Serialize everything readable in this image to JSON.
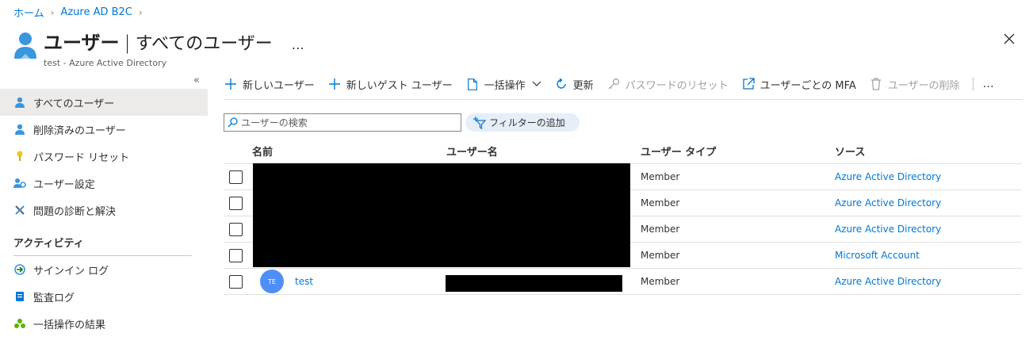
{
  "breadcrumb": [
    {
      "label": "ホーム"
    },
    {
      "label": "Azure AD B2C"
    }
  ],
  "header": {
    "title": "ユーザー",
    "separator": "|",
    "subtitle_view": "すべてのユーザー",
    "more": "…",
    "subtitle": "test - Azure Active Directory"
  },
  "sidebar": {
    "collapse": "«",
    "items": [
      {
        "label": "すべてのユーザー",
        "icon": "user-icon",
        "active": true
      },
      {
        "label": "削除済みのユーザー",
        "icon": "user-icon"
      },
      {
        "label": "パスワード リセット",
        "icon": "key-icon"
      },
      {
        "label": "ユーザー設定",
        "icon": "user-settings-icon"
      },
      {
        "label": "問題の診断と解決",
        "icon": "wrench-icon"
      }
    ],
    "section": "アクティビティ",
    "activity_items": [
      {
        "label": "サインイン ログ",
        "icon": "sign-in-icon"
      },
      {
        "label": "監査ログ",
        "icon": "audit-log-icon"
      },
      {
        "label": "一括操作の結果",
        "icon": "bulk-results-icon"
      }
    ]
  },
  "toolbar": {
    "new_user": "新しいユーザー",
    "new_guest": "新しいゲスト ユーザー",
    "bulk": "一括操作",
    "refresh": "更新",
    "reset_password": "パスワードのリセット",
    "mfa": "ユーザーごとの MFA",
    "delete_user": "ユーザーの削除",
    "more": "…"
  },
  "search": {
    "placeholder": "ユーザーの検索"
  },
  "filter": {
    "label": "フィルターの追加"
  },
  "table": {
    "headers": [
      "名前",
      "ユーザー名",
      "ユーザー タイプ",
      "ソース"
    ],
    "rows": [
      {
        "name": "",
        "username": "",
        "type": "Member",
        "source": "Azure Active Directory"
      },
      {
        "name": "",
        "username": "",
        "type": "Member",
        "source": "Azure Active Directory"
      },
      {
        "name": "",
        "username": "",
        "type": "Member",
        "source": "Azure Active Directory"
      },
      {
        "name": "",
        "username": "",
        "type": "Member",
        "source": "Microsoft Account"
      },
      {
        "name": "test",
        "initials": "TE",
        "username": "",
        "type": "Member",
        "source": "Azure Active Directory"
      }
    ]
  },
  "colors": {
    "accent": "#0078d4",
    "avatar": "#4f8ef7",
    "active_bg": "#edebe9"
  }
}
